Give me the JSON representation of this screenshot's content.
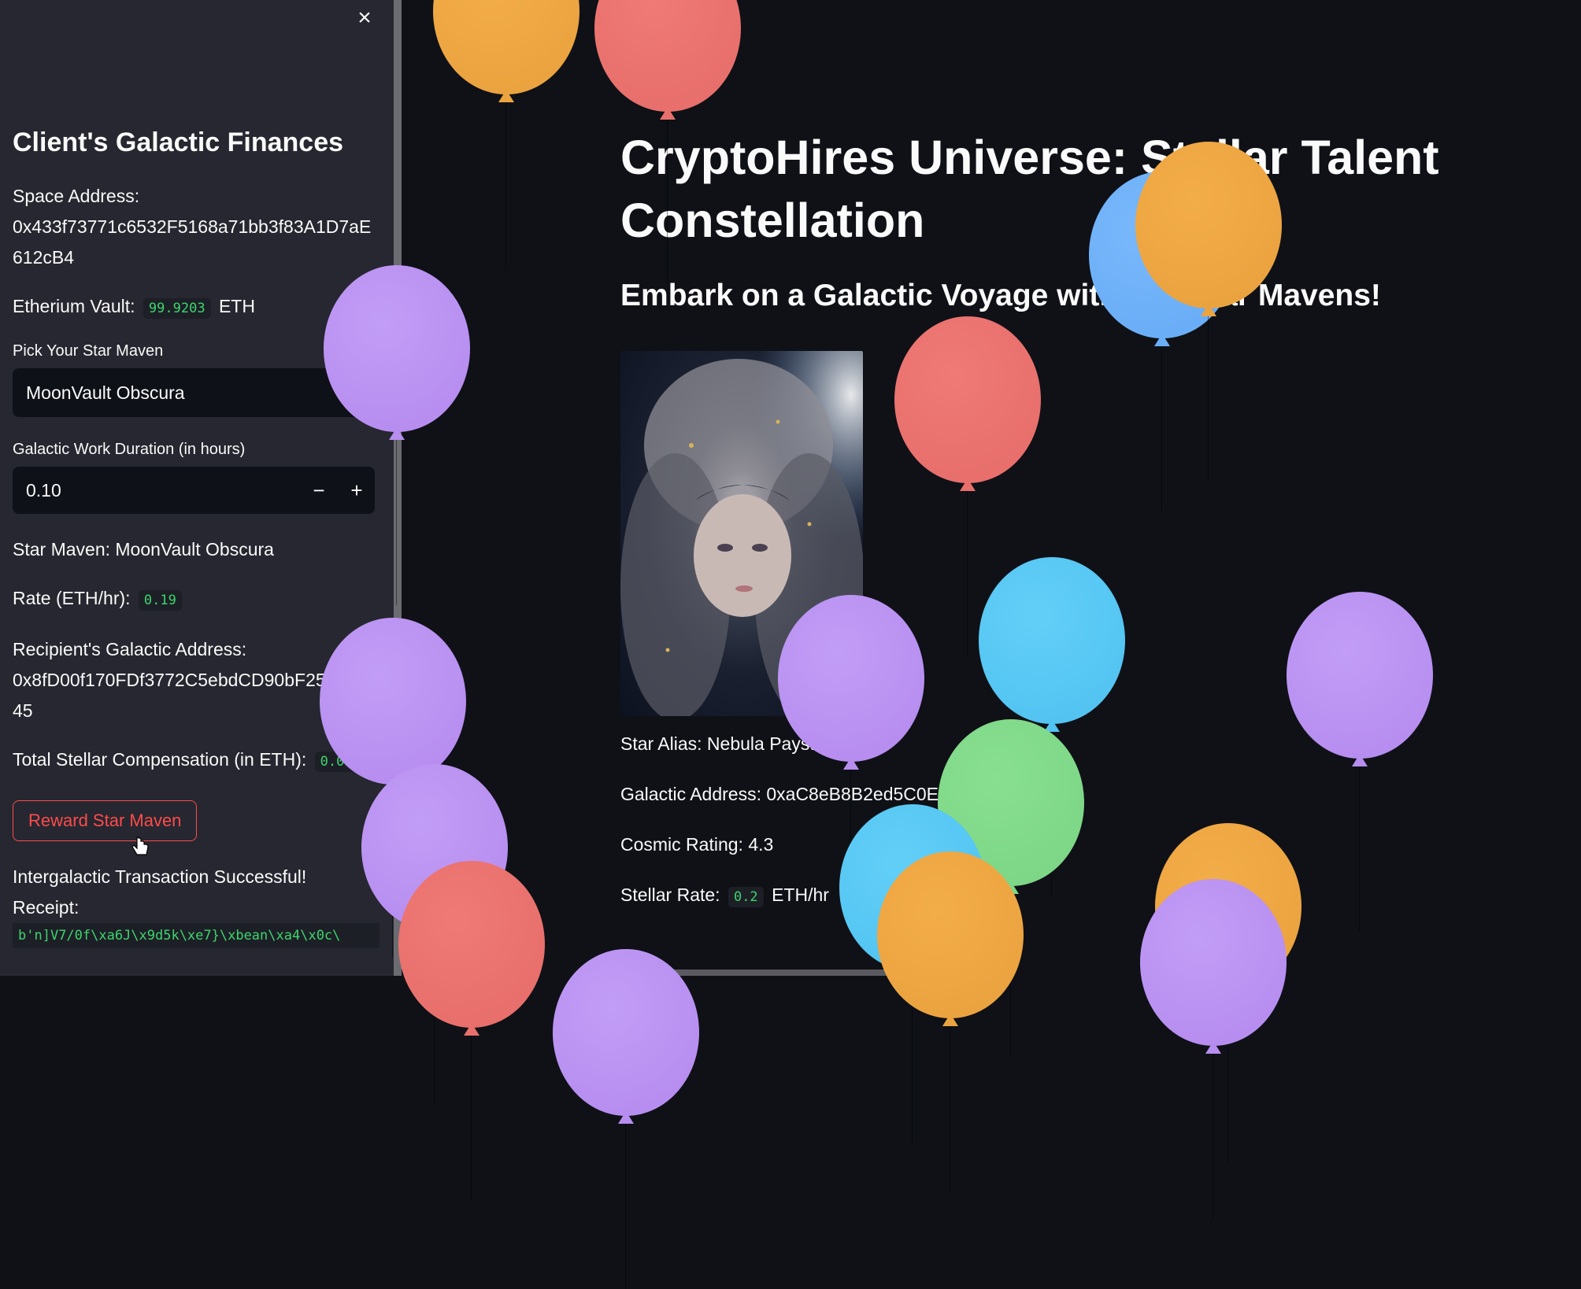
{
  "sidebar": {
    "title": "Client's Galactic Finances",
    "space_address_label": "Space Address:",
    "space_address": "0x433f73771c6532F5168a71bb3f83A1D7aE612cB4",
    "vault_label": "Etherium Vault:",
    "vault_value": "99.9203",
    "vault_unit": "ETH",
    "pick_label": "Pick Your Star Maven",
    "pick_value": "MoonVault Obscura",
    "duration_label": "Galactic Work Duration (in hours)",
    "duration_value": "0.10",
    "minus": "−",
    "plus": "+",
    "maven_text": "Star Maven: MoonVault Obscura",
    "rate_label": "Rate (ETH/hr):",
    "rate_value": "0.19",
    "recipient_label": "Recipient's Galactic Address:",
    "recipient_address": "0x8fD00f170FDf3772C5ebdCD90bF2579BA45",
    "total_label": "Total Stellar Compensation (in ETH):",
    "total_value": "0.019",
    "reward_button": "Reward Star Maven",
    "success_text": "Intergalactic Transaction Successful!",
    "receipt_label": "Receipt:",
    "receipt_value": "b'n]V7/0f\\xa6J\\x9d5k\\xe7}\\xbean\\xa4\\x0c\\",
    "close_icon": "×"
  },
  "main": {
    "title": "CryptoHires Universe: Stellar Talent Constellation",
    "subtitle": "Embark on a Galactic Voyage with Our Star Mavens!",
    "alias": "Star Alias: Nebula Paystream",
    "address": "Galactic Address: 0xaC8eB8B2ed5C0E1fA7f67029F0",
    "cosmic_rating": "Cosmic Rating: 4.3",
    "stellar_rate_label": "Stellar Rate:",
    "stellar_rate_value": "0.2",
    "stellar_rate_unit": "ETH/hr"
  },
  "colors": {
    "accent": "#ff4b4b",
    "code_green": "#3dd56d",
    "sidebar_bg": "#262730",
    "main_bg": "#0f1117"
  },
  "icons": {
    "close": "close-icon",
    "cursor": "hand-cursor-icon"
  }
}
